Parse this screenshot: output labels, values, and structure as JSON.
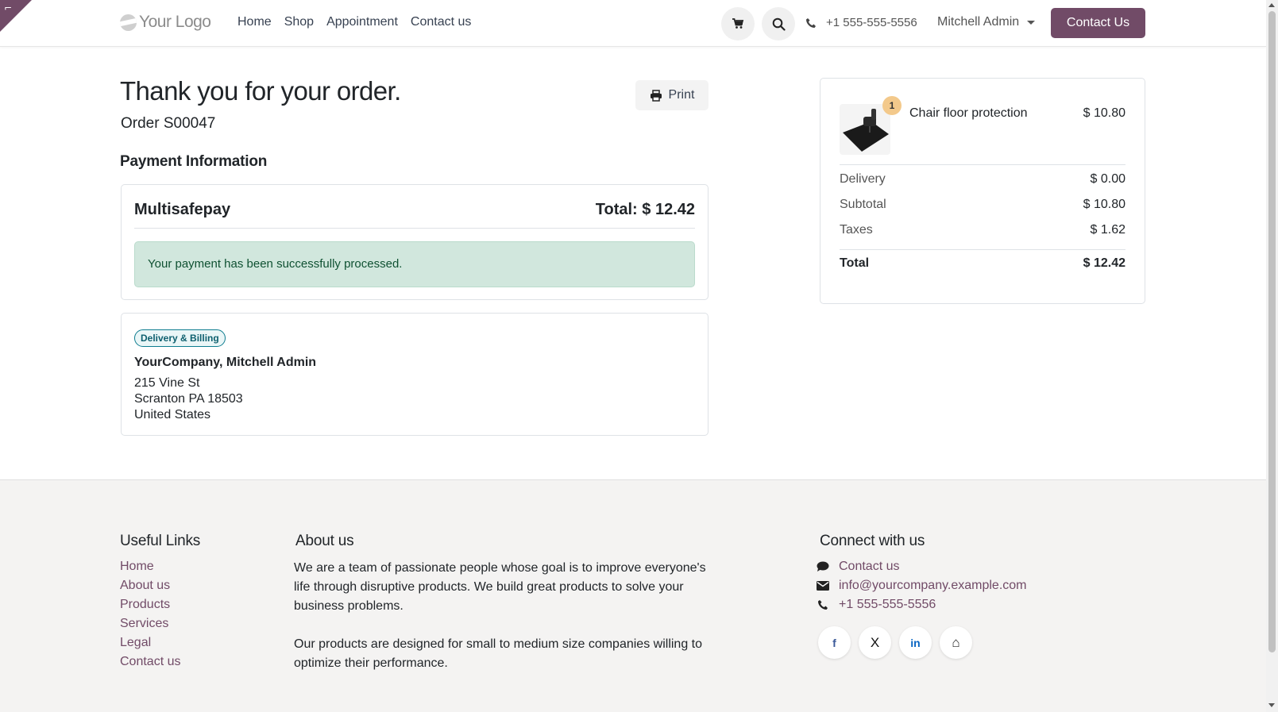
{
  "header": {
    "logo_text": "Your Logo",
    "nav": [
      "Home",
      "Shop",
      "Appointment",
      "Contact us"
    ],
    "phone": "+1 555-555-5556",
    "user": "Mitchell Admin",
    "cta": "Contact Us"
  },
  "order": {
    "title": "Thank you for your order.",
    "ref": "Order S00047",
    "print_label": "Print"
  },
  "payment": {
    "section_title": "Payment Information",
    "method": "Multisafepay",
    "total": "Total: $ 12.42",
    "message": "Your payment has been successfully processed."
  },
  "address": {
    "badge": "Delivery & Billing",
    "name": "YourCompany, Mitchell Admin",
    "line1": "215 Vine St",
    "line2": "Scranton PA 18503",
    "line3": "United States"
  },
  "summary": {
    "product": {
      "name": "Chair floor protection",
      "price": "$ 10.80",
      "qty": "1"
    },
    "rows": [
      {
        "label": "Delivery",
        "value": "$ 0.00"
      },
      {
        "label": "Subtotal",
        "value": "$ 10.80"
      },
      {
        "label": "Taxes",
        "value": "$ 1.62"
      }
    ],
    "total_label": "Total",
    "total_value": "$ 12.42"
  },
  "footer": {
    "links_title": "Useful Links",
    "links": [
      "Home",
      "About us",
      "Products",
      "Services",
      "Legal",
      "Contact us"
    ],
    "about_title": "About us",
    "about_p1": "We are a team of passionate people whose goal is to improve everyone's life through disruptive products. We build great products to solve your business problems.",
    "about_p2": "Our products are designed for small to medium size companies willing to optimize their performance.",
    "connect_title": "Connect with us",
    "contact_link": "Contact us",
    "email": "info@yourcompany.example.com",
    "phone": "+1 555-555-5556",
    "socials": [
      {
        "icon": "facebook-icon",
        "glyph": "f",
        "color": "#3b5998"
      },
      {
        "icon": "x-twitter-icon",
        "glyph": "X",
        "color": "#111111"
      },
      {
        "icon": "linkedin-icon",
        "glyph": "in",
        "color": "#0a66c2"
      },
      {
        "icon": "home-icon",
        "glyph": "⌂",
        "color": "#222222"
      }
    ]
  },
  "colors": {
    "brand": "#714B67",
    "success_bg": "#d1e7dd",
    "success_text": "#0f5132"
  }
}
